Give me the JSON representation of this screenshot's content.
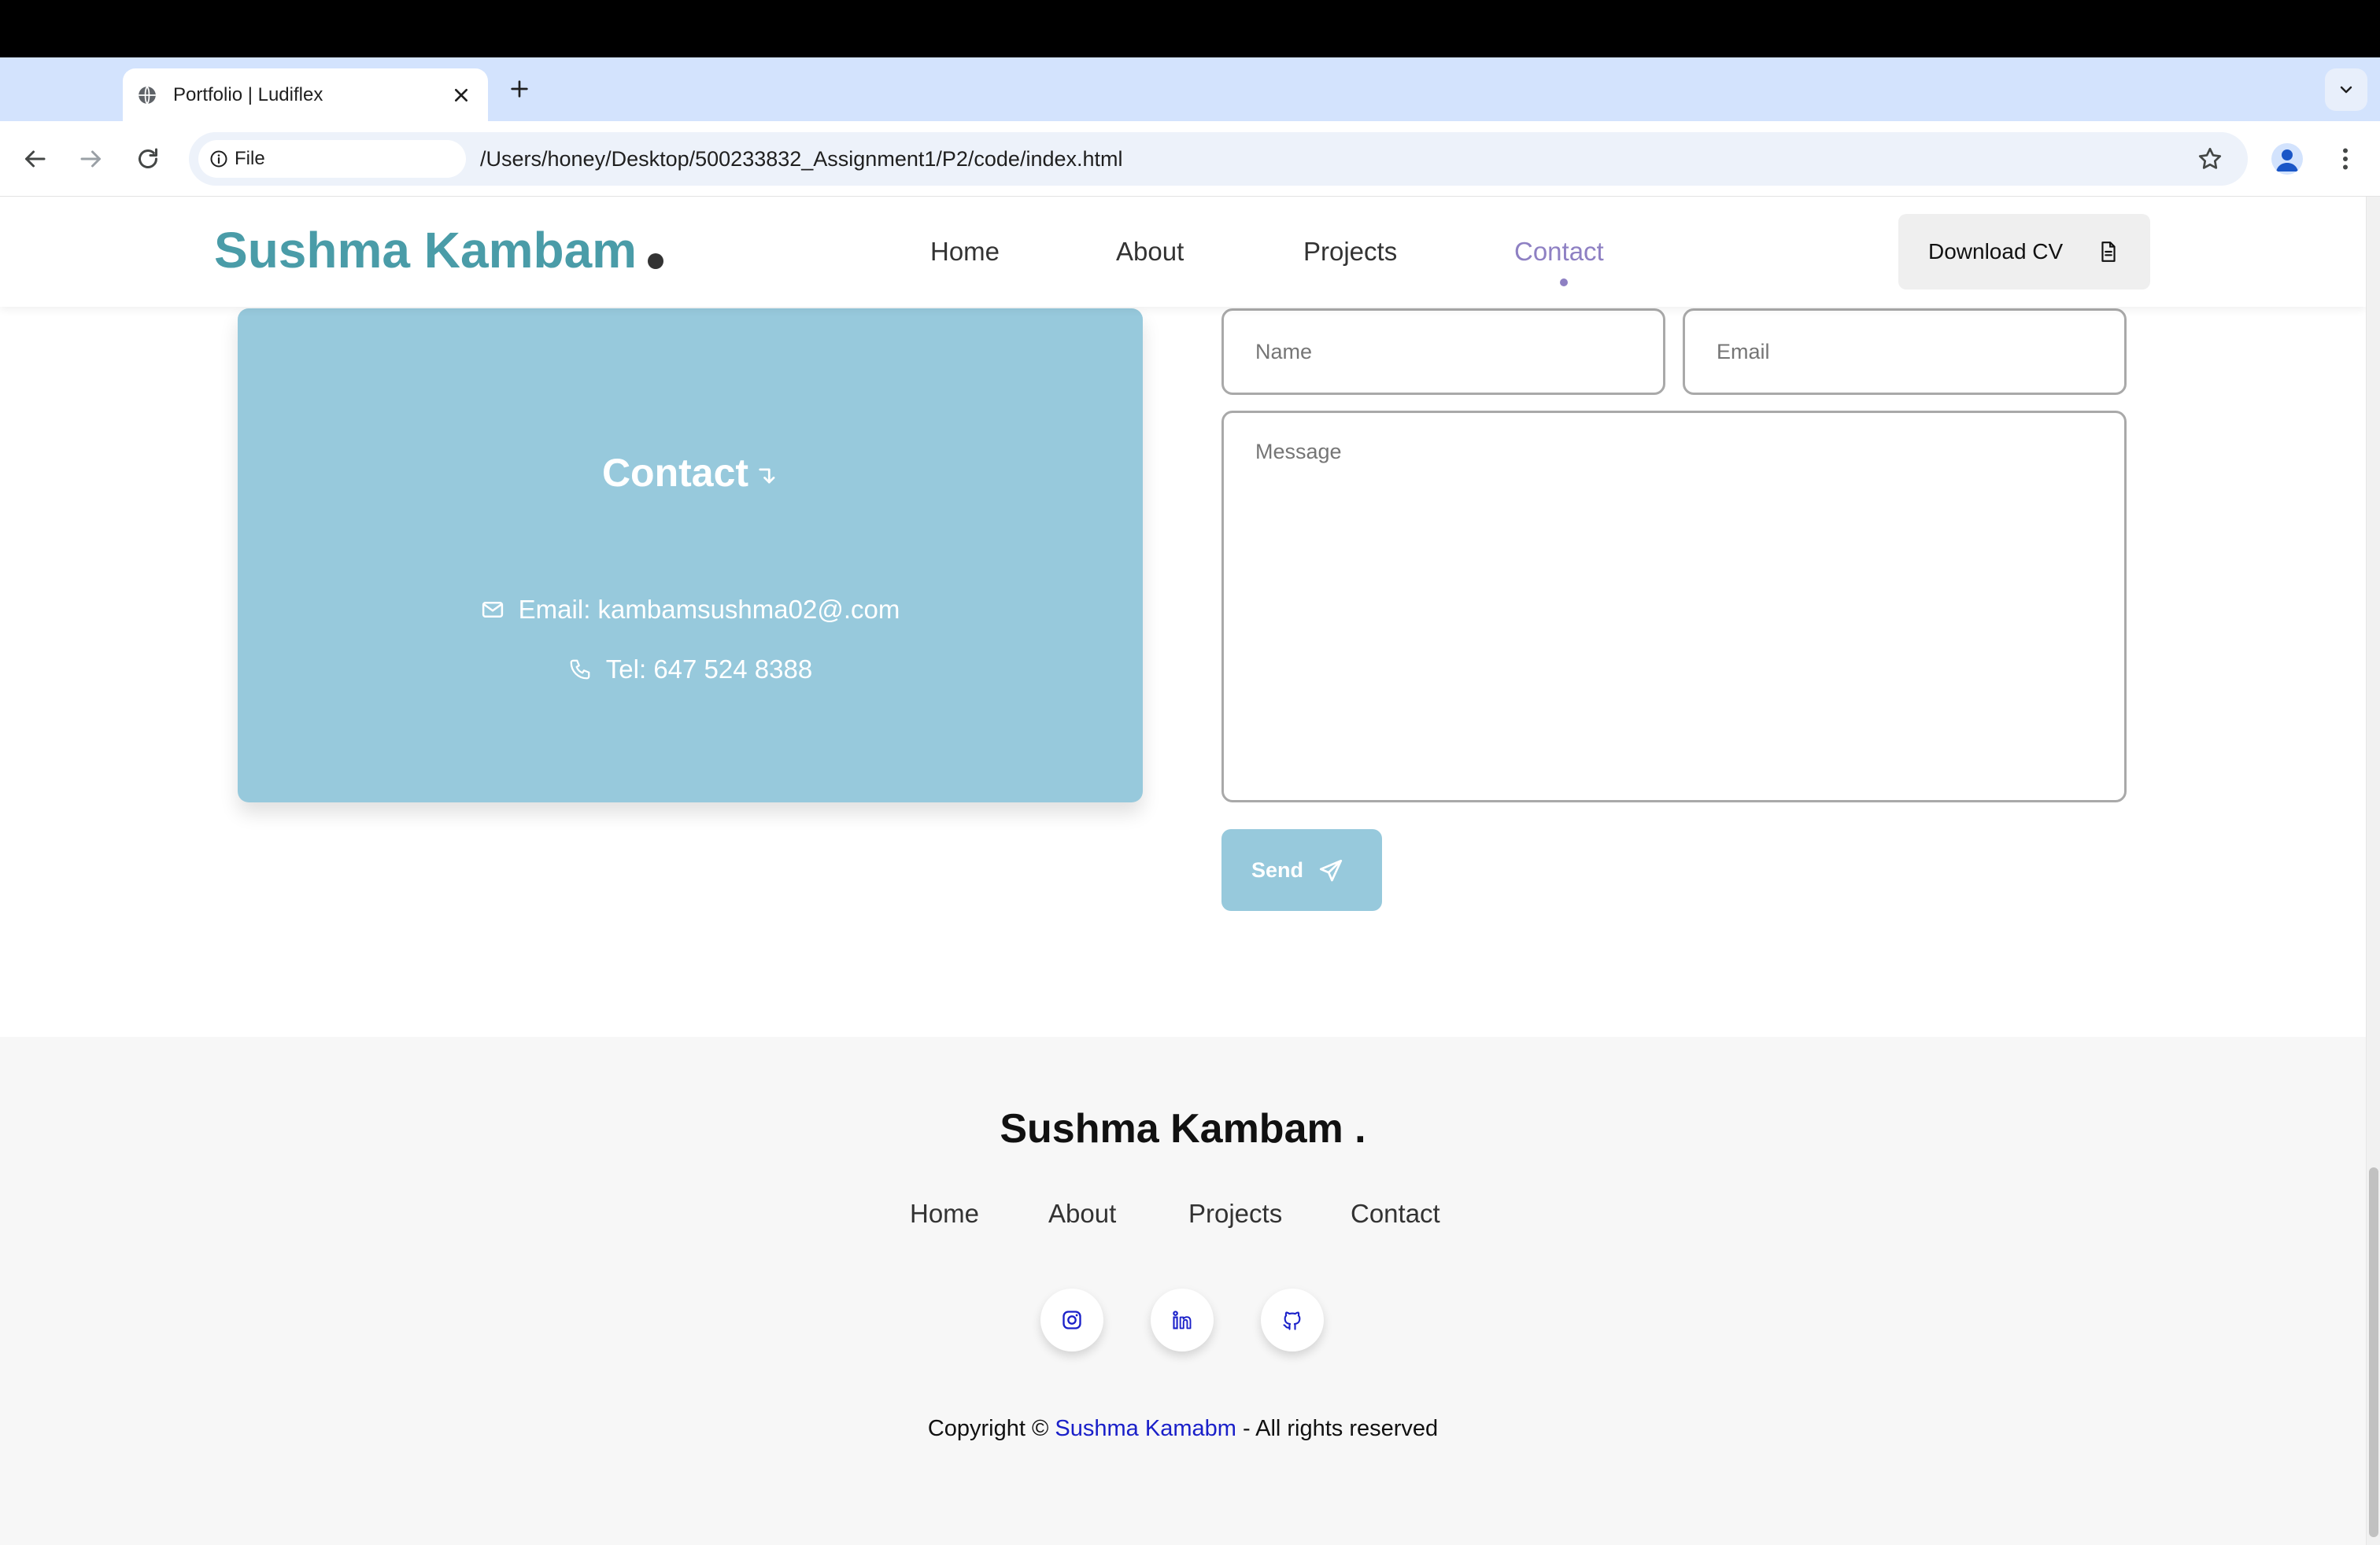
{
  "browser": {
    "tab_title": "Portfolio | Ludiflex",
    "url_chip_label": "File",
    "url": "/Users/honey/Desktop/500233832_Assignment1/P2/code/index.html",
    "icons": [
      "globe-icon",
      "close-icon",
      "plus-icon",
      "chevron-down-icon",
      "back-icon",
      "forward-icon",
      "reload-icon",
      "info-icon",
      "star-icon",
      "profile-icon",
      "more-vert-icon"
    ]
  },
  "header": {
    "logo_text": "Sushma Kambam",
    "nav": [
      {
        "label": "Home"
      },
      {
        "label": "About"
      },
      {
        "label": "Projects"
      },
      {
        "label": "Contact",
        "active": true
      }
    ],
    "download_label": "Download CV",
    "colors": {
      "logo": "#4a9ca8",
      "active_nav": "#8e80c3"
    }
  },
  "contact": {
    "title": "Contact",
    "email_line": "Email: kambamsushma02@.com",
    "tel_line": "Tel: 647 524 8388",
    "card_color": "#97c9dc"
  },
  "form": {
    "name_placeholder": "Name",
    "email_placeholder": "Email",
    "message_placeholder": "Message",
    "send_label": "Send"
  },
  "footer": {
    "title": "Sushma Kambam .",
    "links": [
      {
        "label": "Home"
      },
      {
        "label": "About"
      },
      {
        "label": "Projects"
      },
      {
        "label": "Contact"
      }
    ],
    "social_icons": [
      "instagram-icon",
      "linkedin-icon",
      "github-icon"
    ],
    "copyright_prefix": "Copyright ©",
    "copyright_author": "Sushma Kamabm",
    "copyright_suffix": "- All rights reserved",
    "author_color": "#1a20c9"
  }
}
